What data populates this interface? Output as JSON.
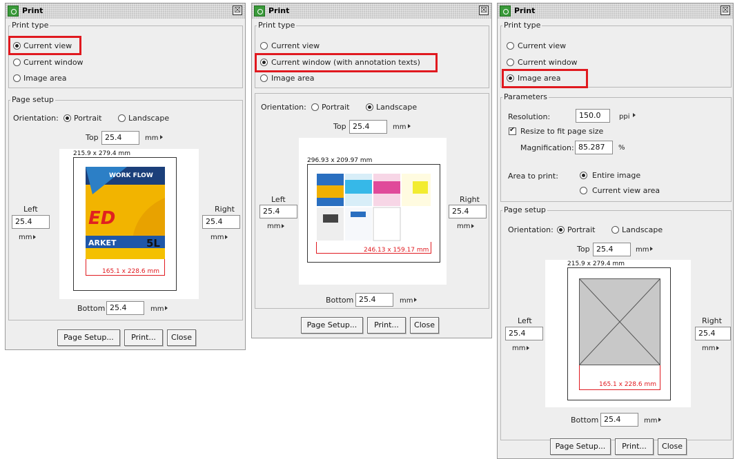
{
  "panels": [
    {
      "title": "Print",
      "print_type_label": "Print type",
      "options": [
        "Current view",
        "Current window",
        "Image area"
      ],
      "selected": "Current view",
      "page_setup_label": "Page setup",
      "orientation_label": "Orientation:",
      "portrait": "Portrait",
      "landscape": "Landscape",
      "orientation_selected": "Portrait",
      "top_label": "Top",
      "top_value": "25.4",
      "left_label": "Left",
      "left_value": "25.4",
      "right_label": "Right",
      "right_value": "25.4",
      "bottom_label": "Bottom",
      "bottom_value": "25.4",
      "unit": "mm",
      "page_size": "215.9 x 279.4 mm",
      "print_size": "165.1 x 228.6 mm",
      "thumb_texts": [
        "WORK FLOW",
        "ED",
        "ARKET",
        "5L"
      ],
      "buttons": [
        "Page Setup...",
        "Print...",
        "Close"
      ]
    },
    {
      "title": "Print",
      "print_type_label": "Print type",
      "options": [
        "Current view",
        "Current window (with annotation texts)",
        "Image area"
      ],
      "selected": "Current window (with annotation texts)",
      "orientation_label": "Orientation:",
      "portrait": "Portrait",
      "landscape": "Landscape",
      "orientation_selected": "Landscape",
      "top_label": "Top",
      "top_value": "25.4",
      "left_label": "Left",
      "left_value": "25.4",
      "right_label": "Right",
      "right_value": "25.4",
      "bottom_label": "Bottom",
      "bottom_value": "25.4",
      "unit": "mm",
      "page_size": "296.93 x 209.97 mm",
      "print_size": "246.13 x 159.17 mm",
      "buttons": [
        "Page Setup...",
        "Print...",
        "Close"
      ]
    },
    {
      "title": "Print",
      "print_type_label": "Print type",
      "options": [
        "Current view",
        "Current window",
        "Image area"
      ],
      "selected": "Image area",
      "parameters_label": "Parameters",
      "resolution_label": "Resolution:",
      "resolution_value": "150.0",
      "resolution_unit": "ppi",
      "resize_label": "Resize to fit page size",
      "resize_checked": true,
      "magnification_label": "Magnification:",
      "magnification_value": "85.287",
      "magnification_unit": "%",
      "area_label": "Area to print:",
      "area_options": [
        "Entire image",
        "Current view area"
      ],
      "area_selected": "Entire image",
      "page_setup_label": "Page setup",
      "orientation_label": "Orientation:",
      "portrait": "Portrait",
      "landscape": "Landscape",
      "orientation_selected": "Portrait",
      "top_label": "Top",
      "top_value": "25.4",
      "left_label": "Left",
      "left_value": "25.4",
      "right_label": "Right",
      "right_value": "25.4",
      "bottom_label": "Bottom",
      "bottom_value": "25.4",
      "unit": "mm",
      "page_size": "215.9 x 279.4 mm",
      "print_size": "165.1 x 228.6 mm",
      "buttons": [
        "Page Setup...",
        "Print...",
        "Close"
      ]
    }
  ],
  "close_glyph": "☒",
  "colors": {
    "highlight": "#e0191f",
    "dialog_bg": "#eeeeee",
    "titlebar": "#c9c9c9"
  }
}
